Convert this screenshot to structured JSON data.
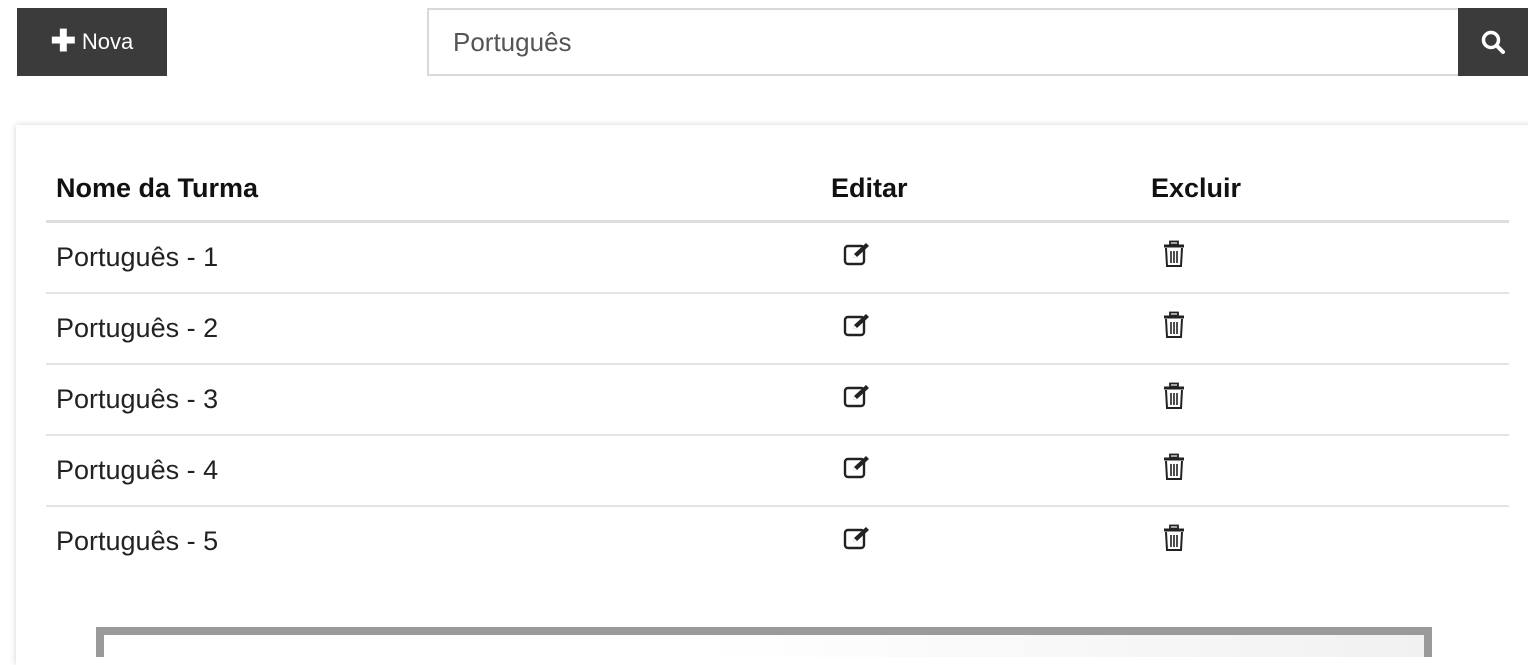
{
  "toolbar": {
    "new_label": "Nova",
    "new_icon": "plus-icon",
    "search_icon": "search-icon"
  },
  "search": {
    "value": "Português",
    "placeholder": ""
  },
  "table": {
    "headers": {
      "name": "Nome da Turma",
      "edit": "Editar",
      "delete": "Excluir"
    },
    "rows": [
      {
        "name": "Português - 1"
      },
      {
        "name": "Português - 2"
      },
      {
        "name": "Português - 3"
      },
      {
        "name": "Português - 4"
      },
      {
        "name": "Português - 5"
      }
    ],
    "edit_icon": "edit-icon",
    "delete_icon": "trash-icon"
  },
  "colors": {
    "button_bg": "#3b3b3b",
    "button_text": "#ffffff"
  }
}
